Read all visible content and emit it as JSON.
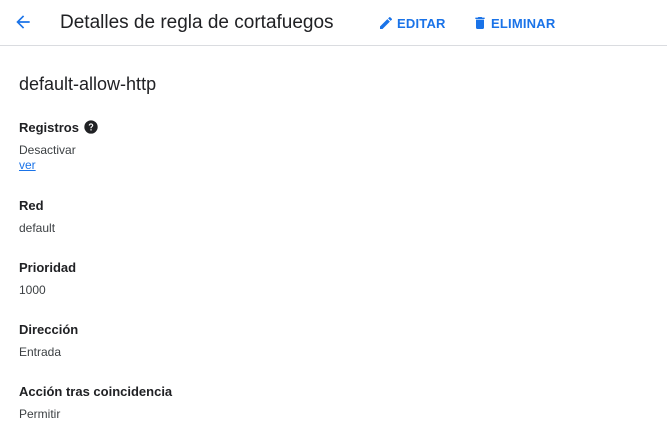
{
  "header": {
    "title": "Detalles de regla de cortafuegos",
    "edit_label": "EDITAR",
    "delete_label": "ELIMINAR"
  },
  "rule": {
    "name": "default-allow-http"
  },
  "fields": {
    "logs": {
      "label": "Registros",
      "value": "Desactivar",
      "link": "ver"
    },
    "network": {
      "label": "Red",
      "value": "default"
    },
    "priority": {
      "label": "Prioridad",
      "value": "1000"
    },
    "direction": {
      "label": "Dirección",
      "value": "Entrada"
    },
    "action": {
      "label": "Acción tras coincidencia",
      "value": "Permitir"
    }
  },
  "icons": {
    "back": "arrow-back-icon",
    "edit": "pencil-icon",
    "delete": "trash-icon",
    "help": "help-icon"
  },
  "colors": {
    "accent": "#1a73e8",
    "text": "#202124",
    "divider": "#dadce0"
  }
}
